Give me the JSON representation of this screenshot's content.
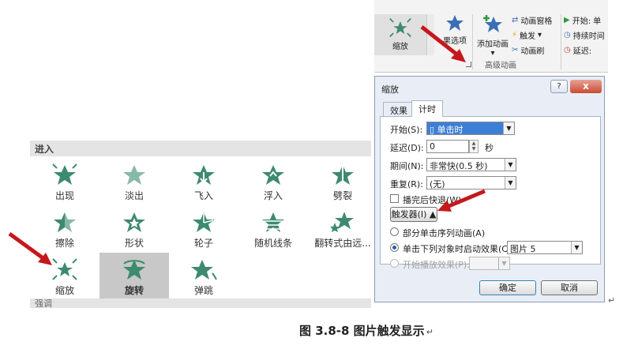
{
  "gallery": {
    "header": "进入",
    "footer": "强调",
    "items": [
      {
        "label": "出现",
        "icon": "burst-star-icon"
      },
      {
        "label": "淡出",
        "icon": "fade-star-icon"
      },
      {
        "label": "飞入",
        "icon": "fly-in-star-icon"
      },
      {
        "label": "浮入",
        "icon": "float-in-star-icon"
      },
      {
        "label": "劈裂",
        "icon": "split-star-icon"
      },
      {
        "label": "擦除",
        "icon": "wipe-star-icon"
      },
      {
        "label": "形状",
        "icon": "shape-star-icon"
      },
      {
        "label": "轮子",
        "icon": "wheel-star-icon"
      },
      {
        "label": "随机线条",
        "icon": "random-bars-star-icon"
      },
      {
        "label": "翻转式由远...",
        "icon": "grow-turn-star-icon"
      },
      {
        "label": "缩放",
        "icon": "zoom-star-icon"
      },
      {
        "label": "旋转",
        "icon": "swivel-star-icon"
      },
      {
        "label": "弹跳",
        "icon": "bounce-star-icon"
      }
    ],
    "selected": "旋转"
  },
  "ribbon": {
    "zoom_label": "缩放",
    "effect_options_label": "果选项",
    "add_animation_label": "添加动画",
    "animation_pane_label": "动画窗格",
    "trigger_label": "触发",
    "animation_painter_label": "动画刷",
    "start_label": "开始:",
    "start_value": "单",
    "duration_label": "持续时间",
    "delay_label": "延迟:",
    "group_label": "高级动画"
  },
  "dialog": {
    "title": "缩放",
    "help": "?",
    "close": "x",
    "tabs": [
      "效果",
      "计时"
    ],
    "active_tab": "计时",
    "start_label": "开始(S):",
    "start_value": "单击时",
    "delay_label": "延迟(D):",
    "delay_value": "0",
    "delay_unit": "秒",
    "duration_label": "期间(N):",
    "duration_value": "非常快(0.5 秒)",
    "repeat_label": "重复(R):",
    "repeat_value": "(无)",
    "rewind_label": "播完后快退(W)",
    "triggers_button": "触发器(I) ▲",
    "option_sequence": "部分单击序列动画(A)",
    "option_click_object": "单击下列对象时启动效果(C):",
    "object_value": "图片 5",
    "option_play_effect": "开始播放效果(P):",
    "ok": "确定",
    "cancel": "取消"
  },
  "caption": "图 3.8-8 图片触发显示",
  "caption_mark": "↵",
  "paragraph_mark": "↵",
  "colors": {
    "star": "#3e8a6f",
    "star_light": "#88b9a6",
    "arrow": "#c6181b",
    "highlight": "#3d7fd6"
  }
}
